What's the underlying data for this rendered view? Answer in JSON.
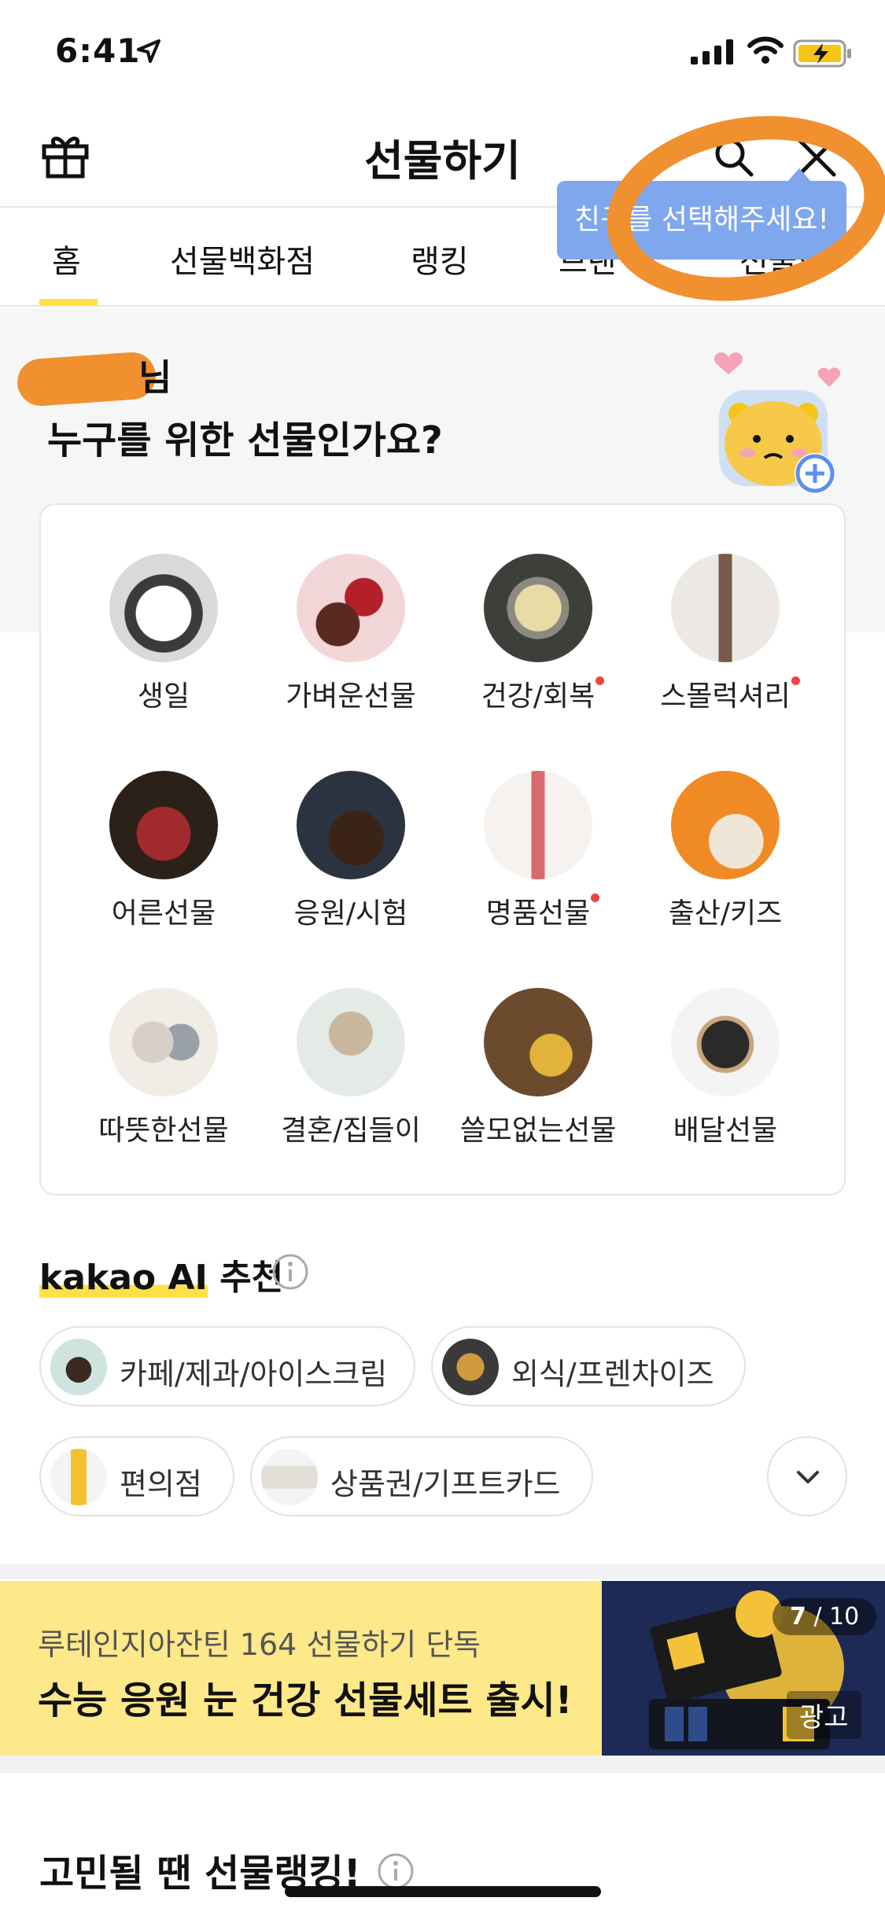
{
  "status_bar": {
    "time": "6:41"
  },
  "header": {
    "title": "선물하기"
  },
  "tabs": [
    {
      "label": "홈"
    },
    {
      "label": "선물백화점"
    },
    {
      "label": "랭킹"
    },
    {
      "label": "브랜"
    },
    {
      "label": "선물함"
    }
  ],
  "hero": {
    "greeting_suffix": "님",
    "question": "누구를 위한 선물인가요?",
    "tooltip": "친구를 선택해주세요!"
  },
  "categories": [
    {
      "label": "생일",
      "new": false
    },
    {
      "label": "가벼운선물",
      "new": false
    },
    {
      "label": "건강/회복",
      "new": true
    },
    {
      "label": "스몰럭셔리",
      "new": true
    },
    {
      "label": "어른선물",
      "new": false
    },
    {
      "label": "응원/시험",
      "new": false
    },
    {
      "label": "명품선물",
      "new": true
    },
    {
      "label": "출산/키즈",
      "new": false
    },
    {
      "label": "따뜻한선물",
      "new": false
    },
    {
      "label": "결혼/집들이",
      "new": false
    },
    {
      "label": "쓸모없는선물",
      "new": false
    },
    {
      "label": "배달선물",
      "new": false
    }
  ],
  "ai_section": {
    "brand": "kakao AI",
    "title": "추천",
    "chips": [
      {
        "label": "카페/제과/아이스크림"
      },
      {
        "label": "외식/프렌차이즈"
      },
      {
        "label": "편의점"
      },
      {
        "label": "상품권/기프트카드"
      }
    ]
  },
  "ad_banner": {
    "line1": "루테인지아잔틴 164 선물하기 단독",
    "line2": "수능 응원 눈 건강 선물세트 출시!",
    "counter_current": "7",
    "counter_total": " / 10",
    "ad_label": "광고"
  },
  "ranking": {
    "title": "고민될 땐 선물랭킹!"
  }
}
